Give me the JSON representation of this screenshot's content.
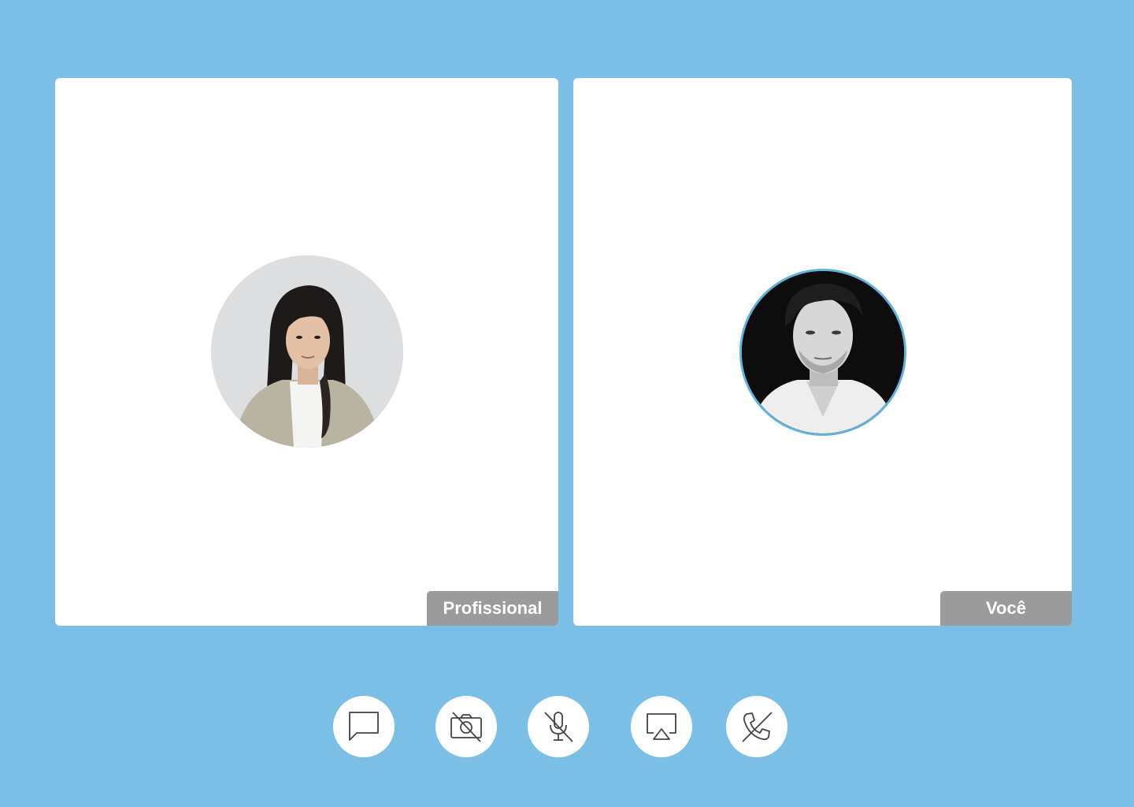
{
  "participants": [
    {
      "label": "Profissional",
      "avatar": "woman-portrait-photo"
    },
    {
      "label": "Você",
      "avatar": "man-portrait-photo"
    }
  ],
  "controls": [
    {
      "icon": "chat-bubble-icon"
    },
    {
      "icon": "camera-off-icon"
    },
    {
      "icon": "mic-off-icon"
    },
    {
      "icon": "airplay-screen-share-icon"
    },
    {
      "icon": "end-call-icon"
    }
  ],
  "colors": {
    "background": "#7bbee6",
    "tile": "#ffffff",
    "label_bg": "#9b9b9b",
    "avatar_ring": "#5fb1e0",
    "icon_stroke": "#444444"
  }
}
